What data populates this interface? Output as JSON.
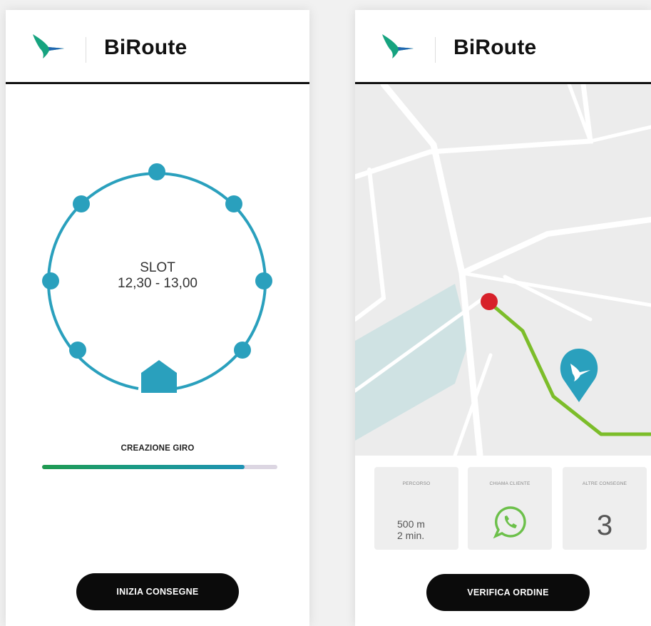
{
  "left_screen": {
    "app_title": "BiRoute",
    "slot_label": "SLOT",
    "slot_time": "12,30 - 13,00",
    "progress_label": "CREAZIONE GIRO",
    "progress_value": 0.86,
    "button_label": "INIZIA CONSEGNE"
  },
  "right_screen": {
    "app_title": "BiRoute",
    "cards": {
      "route": {
        "title": "PERCORSO",
        "distance": "500 m",
        "time": "2 min."
      },
      "call": {
        "title": "CHIAMA CLIENTE",
        "icon": "whatsapp-icon"
      },
      "other": {
        "title": "ALTRE CONSEGNE",
        "count": "3"
      }
    },
    "button_label": "VERIFICA ORDINE"
  },
  "colors": {
    "accent": "#2aa0bd",
    "route": "#7cbd2a",
    "destination": "#d7212a",
    "whatsapp": "#6cc04a",
    "water": "#cfe2e3",
    "button": "#0b0b0b"
  }
}
